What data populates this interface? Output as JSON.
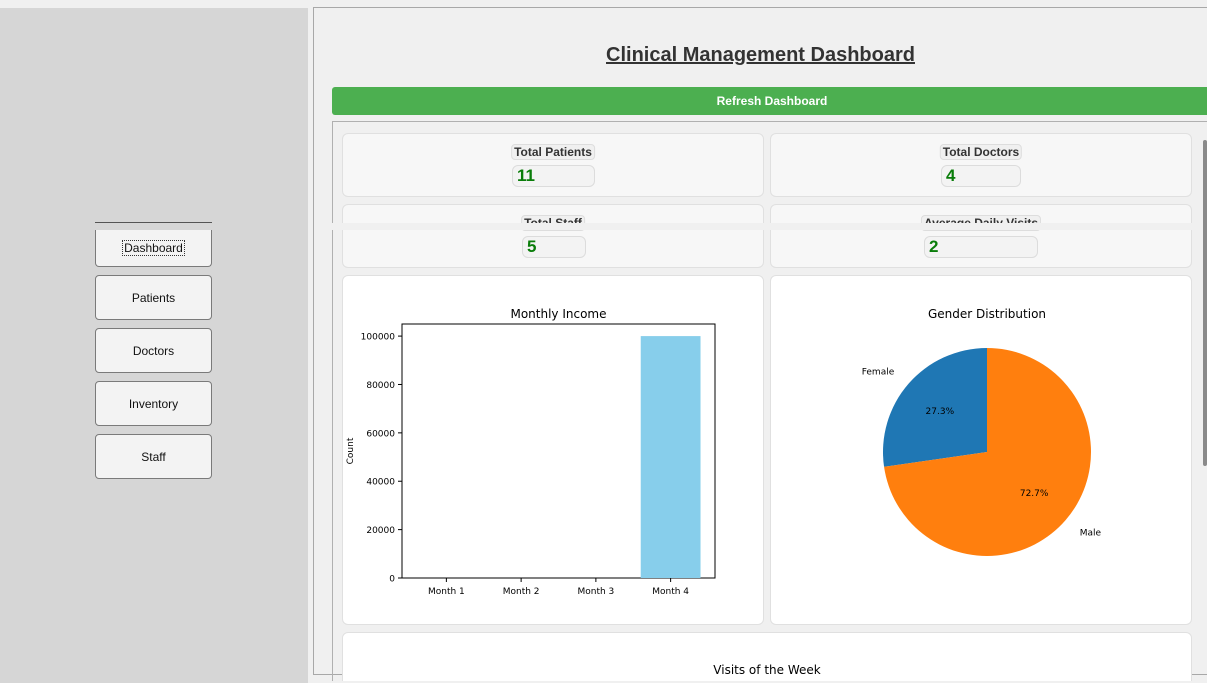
{
  "sidebar": {
    "items": [
      {
        "label": "Dashboard",
        "active": true
      },
      {
        "label": "Patients"
      },
      {
        "label": "Doctors"
      },
      {
        "label": "Inventory"
      },
      {
        "label": "Staff"
      }
    ]
  },
  "main": {
    "title": "Clinical Management Dashboard",
    "refresh_label": "Refresh Dashboard",
    "stats": [
      {
        "label": "Total Patients",
        "value": "11"
      },
      {
        "label": "Total Doctors",
        "value": "4"
      },
      {
        "label": "Total Staff",
        "value": "5"
      },
      {
        "label": "Average Daily Visits",
        "value": "2"
      }
    ],
    "bottom_chart_title": "Visits of the Week"
  },
  "colors": {
    "accent_green": "#4caf50",
    "stat_value": "#0a7d0a",
    "bar": "#87ceeb",
    "pie_female": "#1f77b4",
    "pie_male": "#ff7f0e"
  },
  "chart_data": [
    {
      "type": "bar",
      "title": "Monthly Income",
      "xlabel": "",
      "ylabel": "Count",
      "categories": [
        "Month 1",
        "Month 2",
        "Month 3",
        "Month 4"
      ],
      "values": [
        0,
        0,
        0,
        100000
      ],
      "ylim": [
        0,
        105000
      ],
      "yticks": [
        0,
        20000,
        40000,
        60000,
        80000,
        100000
      ],
      "grid": false
    },
    {
      "type": "pie",
      "title": "Gender Distribution",
      "labels": [
        "Female",
        "Male"
      ],
      "values": [
        3,
        8
      ],
      "percent_labels": [
        "27.3%",
        "72.7%"
      ]
    }
  ]
}
